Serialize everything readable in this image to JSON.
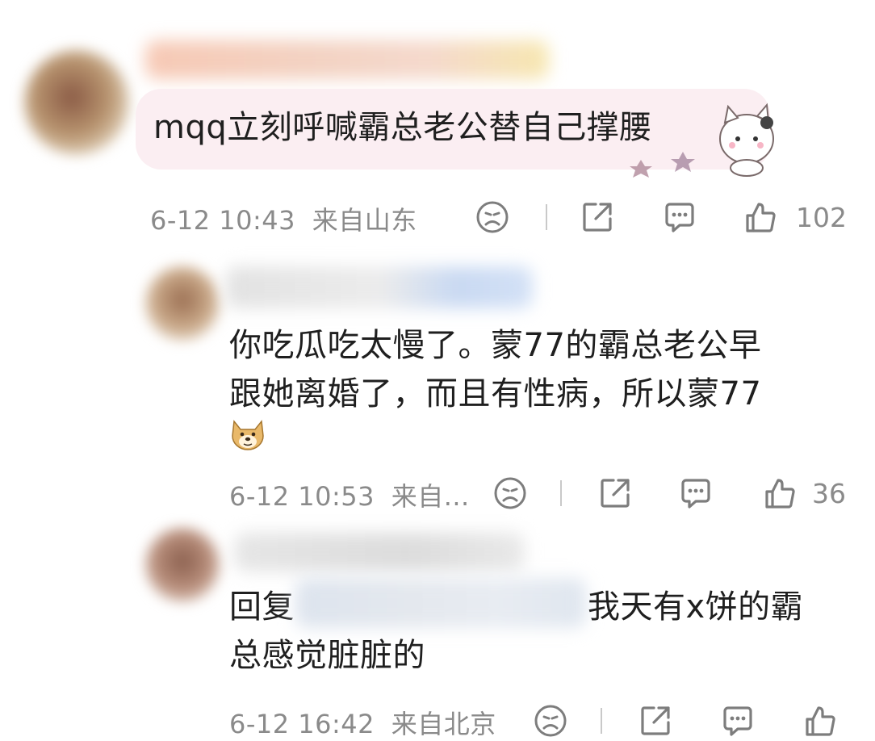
{
  "comments": [
    {
      "text": "mqq立刻呼喊霸总老公替自己撑腰",
      "time": "6-12 10:43",
      "location": "来自山东",
      "likes": "102"
    },
    {
      "text_line1": "你吃瓜吃太慢了。蒙77的霸总老公早",
      "text_line2": "跟她离婚了，而且有性病，所以蒙77",
      "time": "6-12 10:53",
      "location": "来自...",
      "likes": "36"
    },
    {
      "text_line1_prefix": "回复",
      "text_line1_suffix": "我天有x饼的霸",
      "text_line2": "总感觉脏脏的",
      "time": "6-12 16:42",
      "location": "来自北京",
      "likes": ""
    }
  ],
  "icons": {
    "dislike": "frown-face-icon",
    "share": "share-icon",
    "reply": "comment-icon",
    "like": "thumbs-up-icon"
  },
  "colors": {
    "bubble": "#fbeef2",
    "meta": "#8a8a8a"
  }
}
